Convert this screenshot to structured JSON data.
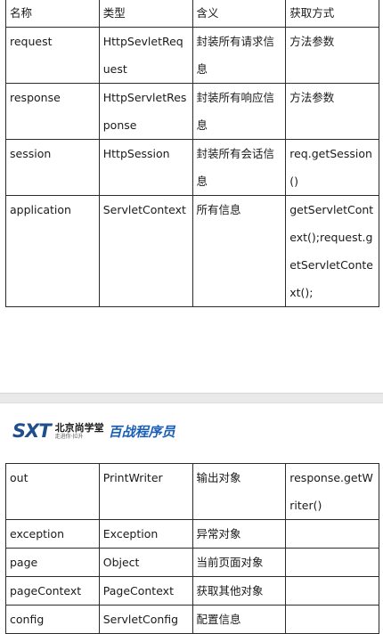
{
  "table1": {
    "header": [
      "名称",
      "类型",
      "含义",
      "获取方式"
    ],
    "rows": [
      [
        "request",
        "HttpSevletRequest",
        "封装所有请求信息",
        "方法参数"
      ],
      [
        "response",
        "HttpServletResponse",
        "封装所有响应信息",
        "方法参数"
      ],
      [
        "session",
        "HttpSession",
        "封装所有会话信息",
        "req.getSession()"
      ],
      [
        "application",
        "ServletContext",
        "所有信息",
        "getServletContext();request.getServletContext();"
      ]
    ]
  },
  "logo": {
    "sxt": "SXT",
    "cn_name": "北京尚学堂",
    "slogan": "走进你·拉升",
    "brand": "百战程序员"
  },
  "table2": {
    "rows": [
      [
        "out",
        "PrintWriter",
        "输出对象",
        "response.getWriter()"
      ],
      [
        "exception",
        "Exception",
        "异常对象",
        ""
      ],
      [
        "page",
        "Object",
        "当前页面对象",
        ""
      ],
      [
        "pageContext",
        "PageContext",
        "获取其他对象",
        ""
      ],
      [
        "config",
        "ServletConfig",
        "配置信息",
        ""
      ]
    ]
  }
}
